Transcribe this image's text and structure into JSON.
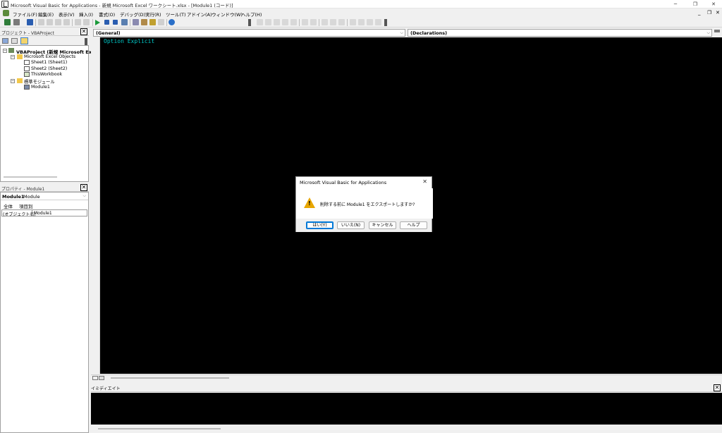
{
  "window": {
    "title": "Microsoft Visual Basic for Applications - 新規 Microsoft Excel ワークシート.xlsx - [Module1 (コード)]",
    "minimize": "─",
    "restore": "❐",
    "close": "✕"
  },
  "menu": {
    "items": [
      "ファイル(F)",
      "編集(E)",
      "表示(V)",
      "挿入(I)",
      "書式(O)",
      "デバッグ(D)",
      "実行(R)",
      "ツール(T)",
      "アドイン(A)",
      "ウィンドウ(W)",
      "ヘルプ(H)"
    ],
    "child_minimize": "_",
    "child_restore": "❐",
    "child_close": "✕"
  },
  "project_pane": {
    "title": "プロジェクト - VBAProject",
    "root": "VBAProject (新規 Microsoft Ex",
    "folder_excel": "Microsoft Excel Objects",
    "sheet1": "Sheet1 (Sheet1)",
    "sheet2": "Sheet2 (Sheet2)",
    "thisworkbook": "ThisWorkbook",
    "folder_modules": "標準モジュール",
    "module1": "Module1",
    "close": "✕"
  },
  "props_pane": {
    "title": "プロパティ - Module1",
    "object_name": "Module1",
    "object_type": "Module",
    "tab_all": "全体",
    "tab_category": "項目別",
    "prop_name": "(オブジェクト名)",
    "prop_value": "Module1",
    "close": "✕"
  },
  "code_window": {
    "object_combo": "(General)",
    "proc_combo": "(Declarations)",
    "code": "Option Explicit"
  },
  "immediate": {
    "title": "イミディエイト",
    "close": "✕"
  },
  "dialog": {
    "title": "Microsoft Visual Basic for Applications",
    "close": "✕",
    "message": "削除する前に Module1 をエクスポートしますか?",
    "yes": "はい(Y)",
    "no": "いいえ(N)",
    "cancel": "キャンセル",
    "help": "ヘルプ"
  },
  "colors": {
    "code_text": "#00c8c8",
    "editor_bg": "#000000",
    "warning": "#e8a600",
    "default_button": "#0078d7"
  }
}
